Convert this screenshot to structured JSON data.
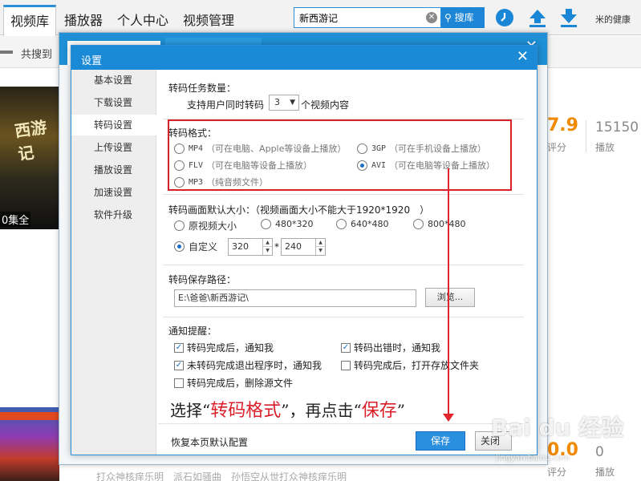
{
  "app": {
    "nav": [
      "视频库",
      "播放器",
      "个人中心",
      "视频管理"
    ],
    "search_value": "新西游记",
    "search_button": "搜库",
    "user": "米的健康",
    "subbar_label": "共搜到",
    "poster1_title": "西游记",
    "poster1_episodes": "0集全",
    "rating": "7.9",
    "rating_label": "评分",
    "plays": "15150",
    "plays_label": "播放",
    "rating2": "0.0",
    "rating2_label": "评分",
    "plays2": "0",
    "plays2_label": "播放",
    "bottom_text": "打众神核痒乐明　派石如骚曲　孙悟空从世打众神核痒乐明"
  },
  "dialog": {
    "title": "设置",
    "sidebar": [
      "基本设置",
      "下载设置",
      "转码设置",
      "上传设置",
      "播放设置",
      "加速设置",
      "软件升级"
    ],
    "active_sidebar": "转码设置",
    "task_count": {
      "title": "转码任务数量：",
      "prefix": "支持用户同时转码",
      "value": "3",
      "suffix": "个视频内容"
    },
    "format": {
      "title": "转码格式：",
      "options": [
        {
          "code": "MP4",
          "desc": "（可在电脑、Apple等设备上播放）",
          "selected": false
        },
        {
          "code": "3GP",
          "desc": "（可在手机设备上播放）",
          "selected": false
        },
        {
          "code": "FLV",
          "desc": "（可在电脑等设备上播放）",
          "selected": false
        },
        {
          "code": "AVI",
          "desc": "（可在电脑等设备上播放）",
          "selected": true
        },
        {
          "code": "MP3",
          "desc": "（纯音频文件）",
          "selected": false
        }
      ]
    },
    "size": {
      "title": "转码画面默认大小：（视频画面大小不能大于1920*1920　）",
      "options": [
        "原视频大小",
        "480*320",
        "640*480",
        "800*480"
      ],
      "custom_label": "自定义",
      "custom_width": "320",
      "custom_height": "240",
      "times": "*"
    },
    "save_path": {
      "title": "转码保存路径：",
      "value": "E:\\爸爸\\新西游记\\",
      "browse": "浏览..."
    },
    "notify": {
      "title": "通知提醒：",
      "options": [
        {
          "label": "转码完成后，通知我",
          "checked": true
        },
        {
          "label": "转码出错时，通知我",
          "checked": true
        },
        {
          "label": "未转码完成退出程序时，通知我",
          "checked": true
        },
        {
          "label": "转码完成后，打开存放文件夹",
          "checked": false
        },
        {
          "label": "转码完成后，删除源文件",
          "checked": false
        }
      ]
    },
    "restore": "恢复本页默认配置",
    "save": "保存",
    "close": "关闭"
  },
  "annotation": {
    "part1": "选择“",
    "part2": "转码格式",
    "part3": "”，再点击“",
    "part4": "保存",
    "part5": "”"
  },
  "watermark": {
    "main": "Bai du 经验",
    "sub": "jingyan.baidu.com"
  },
  "colors": {
    "accent": "#1a8ad6",
    "highlight": "#d91f2a",
    "rating": "#f08a00"
  }
}
